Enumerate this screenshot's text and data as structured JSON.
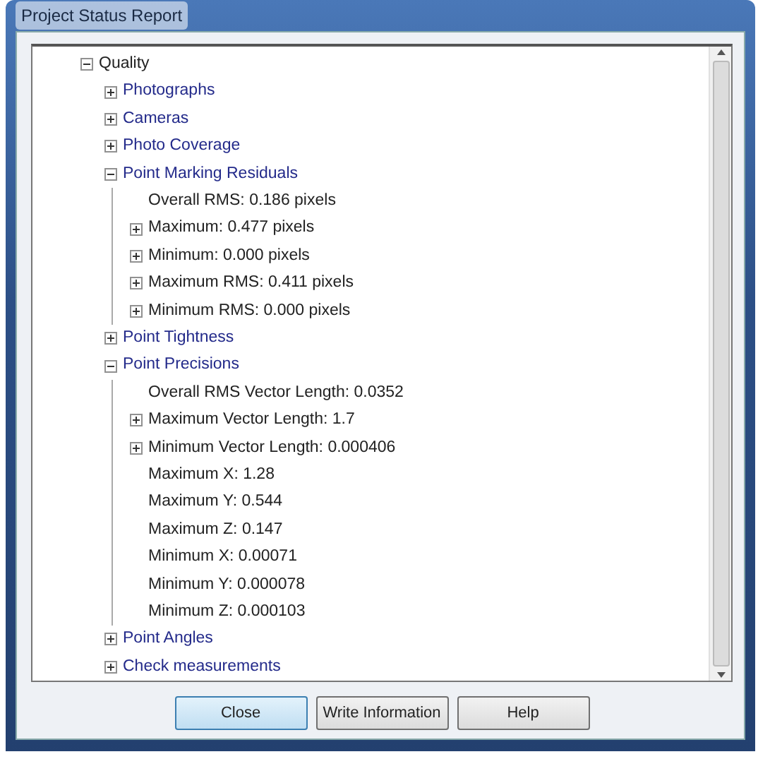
{
  "window": {
    "title": "Project Status Report"
  },
  "tree": [
    {
      "label": "Quality",
      "kind": "node",
      "expanded": true,
      "children": [
        {
          "label": "Photographs",
          "kind": "node",
          "expanded": false
        },
        {
          "label": "Cameras",
          "kind": "node",
          "expanded": false
        },
        {
          "label": "Photo Coverage",
          "kind": "node",
          "expanded": false
        },
        {
          "label": "Point Marking Residuals",
          "kind": "node",
          "expanded": true,
          "children": [
            {
              "label": "Overall RMS: 0.186 pixels",
              "kind": "leaf"
            },
            {
              "label": "Maximum: 0.477 pixels",
              "kind": "node",
              "expanded": false
            },
            {
              "label": "Minimum: 0.000 pixels",
              "kind": "node",
              "expanded": false
            },
            {
              "label": "Maximum RMS: 0.411 pixels",
              "kind": "node",
              "expanded": false
            },
            {
              "label": "Minimum RMS: 0.000 pixels",
              "kind": "node",
              "expanded": false
            }
          ]
        },
        {
          "label": "Point Tightness",
          "kind": "node",
          "expanded": false
        },
        {
          "label": "Point Precisions",
          "kind": "node",
          "expanded": true,
          "children": [
            {
              "label": "Overall RMS Vector Length: 0.0352",
              "kind": "leaf"
            },
            {
              "label": "Maximum Vector Length: 1.7",
              "kind": "node",
              "expanded": false
            },
            {
              "label": "Minimum Vector Length: 0.000406",
              "kind": "node",
              "expanded": false
            },
            {
              "label": "Maximum X: 1.28",
              "kind": "leaf"
            },
            {
              "label": "Maximum Y: 0.544",
              "kind": "leaf"
            },
            {
              "label": "Maximum Z: 0.147",
              "kind": "leaf"
            },
            {
              "label": "Minimum X: 0.00071",
              "kind": "leaf"
            },
            {
              "label": "Minimum Y: 0.000078",
              "kind": "leaf"
            },
            {
              "label": "Minimum Z: 0.000103",
              "kind": "leaf"
            }
          ]
        },
        {
          "label": "Point Angles",
          "kind": "node",
          "expanded": false
        },
        {
          "label": "Check measurements",
          "kind": "node",
          "expanded": false
        }
      ]
    }
  ],
  "buttons": [
    {
      "label": "Close",
      "kind": "default"
    },
    {
      "label": "Write Information",
      "kind": "normal"
    },
    {
      "label": "Help",
      "kind": "normal"
    }
  ]
}
